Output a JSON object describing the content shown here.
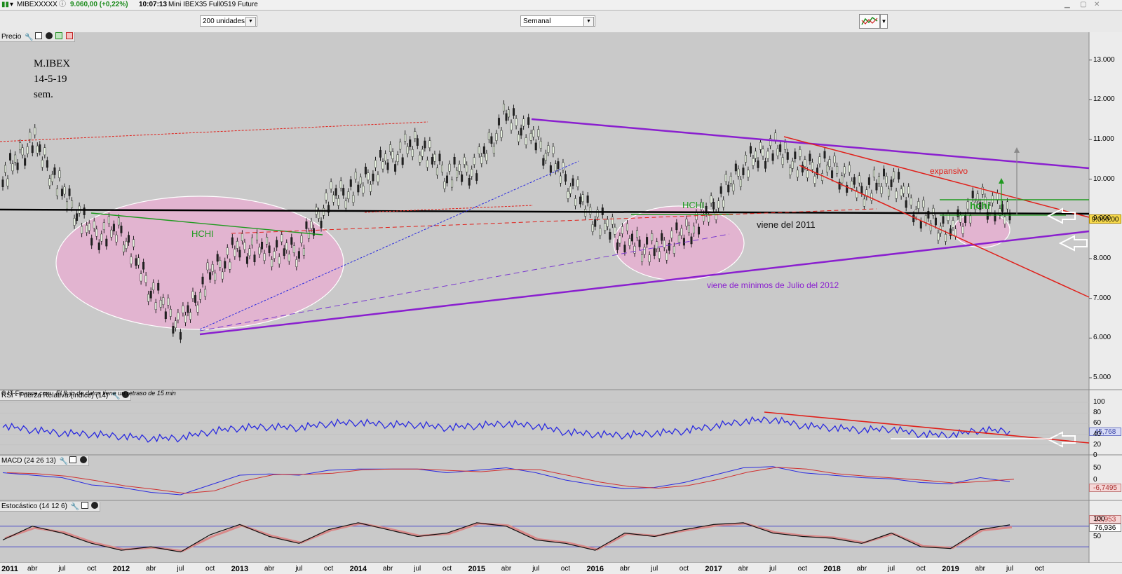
{
  "header": {
    "symbol": "MIBEXXXXX",
    "price_change": "9.060,00 (+0,22%)",
    "time": "10:07:13",
    "instrument": "Mini IBEX35 Full0519 Future"
  },
  "toolbar": {
    "units_select": "200 unidades",
    "period_select": "Semanal",
    "chart_type_icon": "candlestick-chart-icon"
  },
  "panels": {
    "price_label": "Precio",
    "rsi_label": "RSI - Fuerza Relativa (índice) (14)",
    "macd_label": "MACD (24 26 13)",
    "stoch_label": "Estocástico (14 12 6)"
  },
  "credit": {
    "source": "© IT-Finance.com",
    "note": "El flujo de datos tiene un retraso de 15 min"
  },
  "annotations": {
    "title_line1": "M.IBEX",
    "title_line2": "14-5-19",
    "title_line3": "sem.",
    "hchi_left": "HCHI",
    "hchi_mid": "HCHI",
    "hchi_right": "hchi",
    "expansivo": "expansivo",
    "viene_2011": "viene del 2011",
    "viene_julio": "viene de mínimos de Julio del 2012"
  },
  "colors": {
    "background": "#c9c9c9",
    "purple_trend": "#8a1fcf",
    "red_channel": "#e0201a",
    "green_neckline": "#1f9a1f",
    "rsi_line": "#2a2ae0",
    "ellipse_fill": "#e2b4d0"
  },
  "chart_data": [
    {
      "type": "line",
      "name": "price",
      "title": "",
      "x": [
        "2011-01",
        "2011-04",
        "2011-07",
        "2011-10",
        "2012-01",
        "2012-04",
        "2012-07",
        "2012-10",
        "2013-01",
        "2013-04",
        "2013-07",
        "2013-10",
        "2014-01",
        "2014-04",
        "2014-07",
        "2014-10",
        "2015-01",
        "2015-04",
        "2015-07",
        "2015-10",
        "2016-01",
        "2016-04",
        "2016-07",
        "2016-10",
        "2017-01",
        "2017-04",
        "2017-07",
        "2017-10",
        "2018-01",
        "2018-04",
        "2018-07",
        "2018-10",
        "2019-01",
        "2019-04",
        "2019-05"
      ],
      "values": [
        10000,
        11000,
        9700,
        8600,
        8700,
        7200,
        6300,
        7600,
        8300,
        8200,
        8200,
        9500,
        9800,
        10500,
        10900,
        10100,
        10300,
        11600,
        11000,
        10000,
        9000,
        8500,
        8200,
        8600,
        9300,
        10300,
        10800,
        10300,
        10300,
        9700,
        10000,
        9100,
        8700,
        9500,
        9060
      ],
      "y_ticks": [
        "5.000",
        "6.000",
        "7.000",
        "8.000",
        "9.000",
        "10.000",
        "11.000",
        "12.000",
        "13.000"
      ],
      "ylim": [
        4700,
        13700
      ],
      "last_value_label": "9.060,00",
      "x_tick_labels": [
        "2011",
        "abr",
        "jul",
        "oct",
        "2012",
        "abr",
        "jul",
        "oct",
        "2013",
        "abr",
        "jul",
        "oct",
        "2014",
        "abr",
        "jul",
        "oct",
        "2015",
        "abr",
        "jul",
        "oct",
        "2016",
        "abr",
        "jul",
        "oct",
        "2017",
        "abr",
        "jul",
        "oct",
        "2018",
        "abr",
        "jul",
        "oct",
        "2019",
        "abr",
        "jul",
        "oct"
      ]
    },
    {
      "type": "line",
      "name": "rsi",
      "title": "",
      "values": [
        55,
        48,
        42,
        40,
        36,
        32,
        33,
        45,
        52,
        54,
        52,
        60,
        62,
        58,
        58,
        52,
        56,
        60,
        56,
        44,
        40,
        38,
        42,
        46,
        55,
        64,
        68,
        56,
        52,
        48,
        50,
        40,
        38,
        48,
        45.768
      ],
      "y_ticks": [
        "0",
        "20",
        "40",
        "60",
        "80",
        "100"
      ],
      "ylim": [
        0,
        100
      ],
      "last_value_label": "45,768"
    },
    {
      "type": "line",
      "name": "macd",
      "title": "",
      "values": [
        30,
        20,
        10,
        -20,
        -30,
        -50,
        -60,
        -20,
        20,
        25,
        20,
        40,
        45,
        45,
        45,
        30,
        40,
        50,
        30,
        0,
        -20,
        -35,
        -30,
        -10,
        20,
        50,
        55,
        30,
        20,
        10,
        5,
        -10,
        -15,
        10,
        -6.7495
      ],
      "y_ticks": [
        "50",
        "0"
      ],
      "last_value_label": "-6,7495"
    },
    {
      "type": "line",
      "name": "stochastic",
      "title": "",
      "values": [
        40,
        80,
        60,
        30,
        10,
        20,
        5,
        55,
        85,
        50,
        30,
        70,
        90,
        70,
        50,
        60,
        90,
        80,
        40,
        30,
        10,
        60,
        50,
        70,
        85,
        90,
        60,
        50,
        45,
        30,
        60,
        20,
        15,
        70,
        83.953
      ],
      "values_slow": [
        45,
        75,
        62,
        32,
        12,
        18,
        8,
        50,
        82,
        52,
        32,
        68,
        88,
        72,
        52,
        58,
        88,
        82,
        42,
        32,
        12,
        58,
        52,
        68,
        82,
        88,
        62,
        52,
        47,
        32,
        58,
        22,
        17,
        68,
        76.936
      ],
      "y_ticks": [
        "50",
        "100"
      ],
      "last_value_label": "83,953",
      "last_value_label_2": "76,936"
    }
  ]
}
